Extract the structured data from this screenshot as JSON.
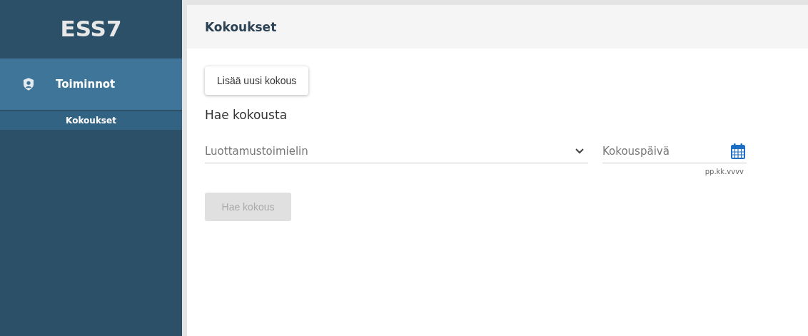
{
  "sidebar": {
    "logo": "ESS7",
    "section": {
      "label": "Toiminnot",
      "items": [
        {
          "label": "Kokoukset",
          "selected": true
        }
      ]
    }
  },
  "header": {
    "title": "Kokoukset"
  },
  "add_button": {
    "label": "Lisää uusi kokous",
    "disabled": false
  },
  "search": {
    "heading": "Hae kokousta",
    "select": {
      "placeholder": "Luottamustoimielin"
    },
    "date": {
      "placeholder": "Kokouspäivä",
      "hint": "pp.kk.vvvv"
    },
    "button": {
      "label": "Hae kokous",
      "disabled": true
    }
  }
}
